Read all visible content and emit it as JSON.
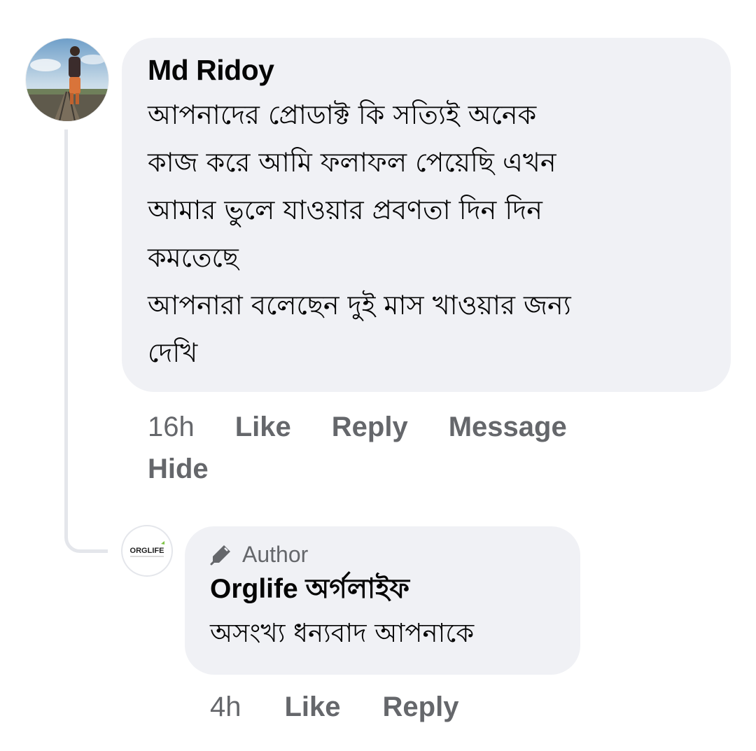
{
  "comment": {
    "author": "Md Ridoy",
    "text": "আপনাদের প্রোডাক্ট কি সত্যিই অনেক\nকাজ করে আমি ফলাফল পেয়েছি এখন\nআমার ভুলে যাওয়ার প্রবণতা দিন দিন\nকমতেছে\nআপনারা বলেছেন দুই মাস খাওয়ার জন্য\nদেখি",
    "time": "16h",
    "actions": {
      "like": "Like",
      "reply": "Reply",
      "message": "Message",
      "hide": "Hide"
    }
  },
  "reply": {
    "badge": "Author",
    "author": "Orglife অর্গলাইফ",
    "logo_text": "ORGLIFE",
    "text": "অসংখ্য ধন্যবাদ আপনাকে",
    "time": "4h",
    "actions": {
      "like": "Like",
      "reply": "Reply"
    }
  },
  "icons": {
    "badge_icon": "pencil-icon"
  },
  "colors": {
    "bubble": "#f0f1f5",
    "secondary_text": "#65676b",
    "thread_line": "#e4e6eb",
    "logo_green": "#7cc242"
  }
}
